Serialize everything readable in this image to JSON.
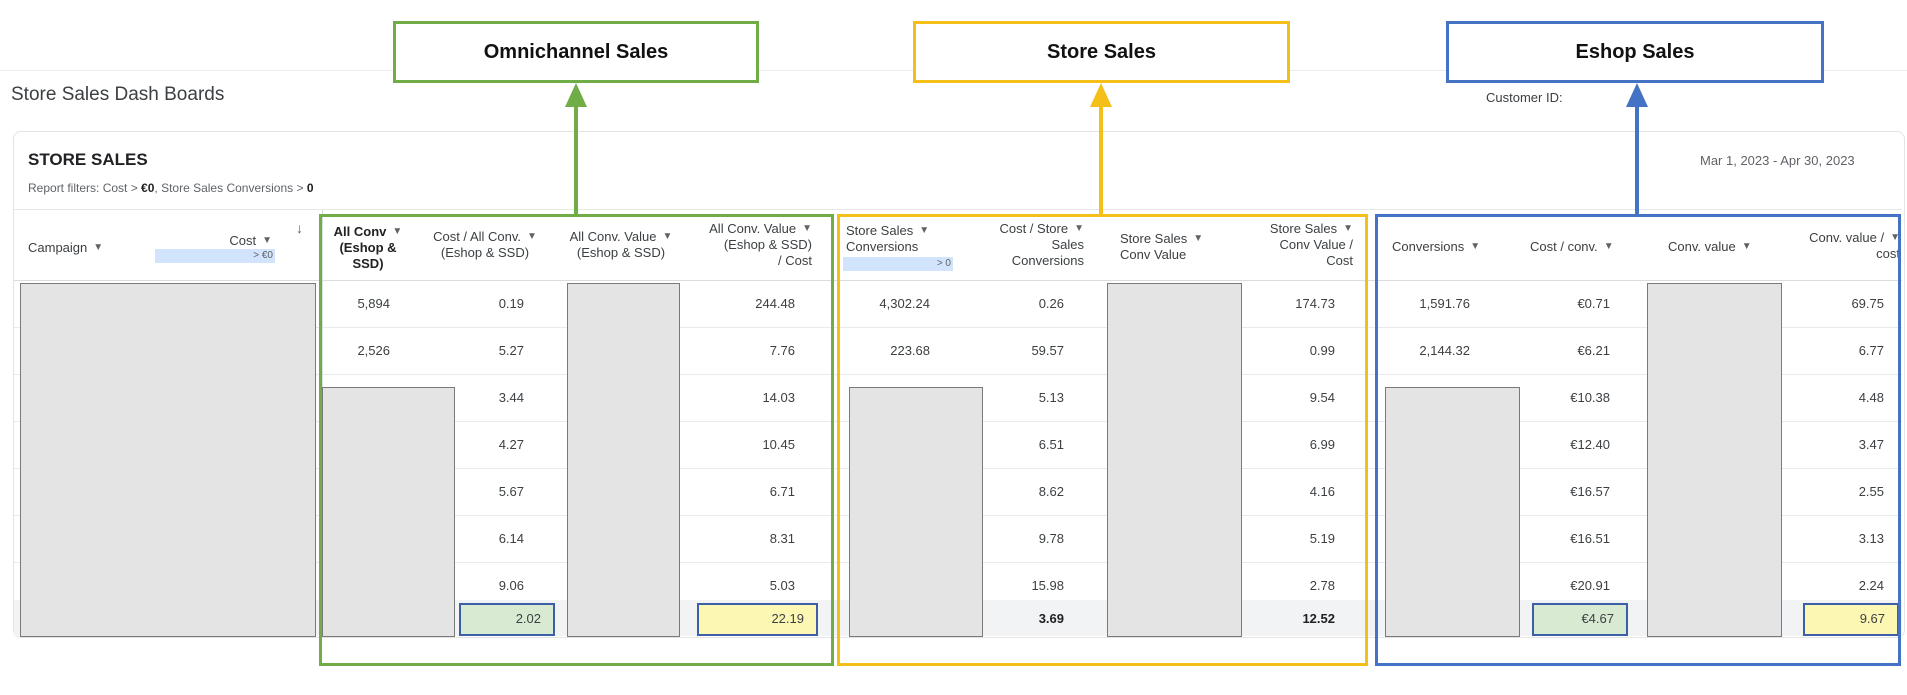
{
  "page_title": "Store Sales Dash Boards",
  "customer_id_label": "Customer ID:",
  "card": {
    "title": "STORE SALES",
    "filters_prefix": "Report filters: Cost > ",
    "filter_cost": "€0",
    "filters_mid": ", Store Sales Conversions > ",
    "filter_conv": "0",
    "date_range": "Mar 1, 2023 - Apr 30, 2023"
  },
  "callouts": {
    "omni": "Omnichannel Sales",
    "store": "Store Sales",
    "eshop": "Eshop Sales"
  },
  "colors": {
    "green": "#70ad47",
    "yellow": "#f5bf1a",
    "blue": "#4472c4",
    "highlight_green": "#d9ead3",
    "highlight_yellow": "#fcf8b3"
  },
  "headers": {
    "campaign": "Campaign",
    "cost": "Cost",
    "cost_filter": "> €0",
    "all_conv_1": "All Conv",
    "all_conv_2": "(Eshop &",
    "all_conv_3": "SSD)",
    "cost_all_conv_1": "Cost / All Conv.",
    "cost_all_conv_2": "(Eshop & SSD)",
    "all_conv_value_1": "All Conv. Value",
    "all_conv_value_2": "(Eshop & SSD)",
    "roas_all_1": "All Conv. Value",
    "roas_all_2": "(Eshop & SSD)",
    "roas_all_3": "/ Cost",
    "ss_conv_1": "Store Sales",
    "ss_conv_2": "Conversions",
    "ss_conv_filter": "> 0",
    "cost_ss_1": "Cost / Store",
    "cost_ss_2": "Sales",
    "cost_ss_3": "Conversions",
    "ss_value_1": "Store Sales",
    "ss_value_2": "Conv Value",
    "ss_roas_1": "Store Sales",
    "ss_roas_2": "Conv Value /",
    "ss_roas_3": "Cost",
    "conversions": "Conversions",
    "cost_conv": "Cost / conv.",
    "conv_value": "Conv. value",
    "conv_value_cost_1": "Conv. value /",
    "conv_value_cost_2": "cost"
  },
  "rows": [
    {
      "all_conv": "5,894",
      "cost_all_conv": "0.19",
      "roas_all": "244.48",
      "ss_conv": "4,302.24",
      "cost_ss": "0.26",
      "ss_roas": "174.73",
      "conversions": "1,591.76",
      "cost_conv": "€0.71",
      "conv_value_cost": "69.75"
    },
    {
      "all_conv": "2,526",
      "cost_all_conv": "5.27",
      "roas_all": "7.76",
      "ss_conv": "223.68",
      "cost_ss": "59.57",
      "ss_roas": "0.99",
      "conversions": "2,144.32",
      "cost_conv": "€6.21",
      "conv_value_cost": "6.77"
    },
    {
      "cost_all_conv": "3.44",
      "roas_all": "14.03",
      "cost_ss": "5.13",
      "ss_roas": "9.54",
      "cost_conv": "€10.38",
      "conv_value_cost": "4.48"
    },
    {
      "cost_all_conv": "4.27",
      "roas_all": "10.45",
      "cost_ss": "6.51",
      "ss_roas": "6.99",
      "cost_conv": "€12.40",
      "conv_value_cost": "3.47"
    },
    {
      "cost_all_conv": "5.67",
      "roas_all": "6.71",
      "cost_ss": "8.62",
      "ss_roas": "4.16",
      "cost_conv": "€16.57",
      "conv_value_cost": "2.55"
    },
    {
      "cost_all_conv": "6.14",
      "roas_all": "8.31",
      "cost_ss": "9.78",
      "ss_roas": "5.19",
      "cost_conv": "€16.51",
      "conv_value_cost": "3.13"
    },
    {
      "cost_all_conv": "9.06",
      "roas_all": "5.03",
      "cost_ss": "15.98",
      "ss_roas": "2.78",
      "cost_conv": "€20.91",
      "conv_value_cost": "2.24"
    }
  ],
  "totals": {
    "cost_all_conv": "2.02",
    "roas_all": "22.19",
    "cost_ss": "3.69",
    "ss_roas": "12.52",
    "cost_conv": "€4.67",
    "conv_value_cost": "9.67"
  }
}
